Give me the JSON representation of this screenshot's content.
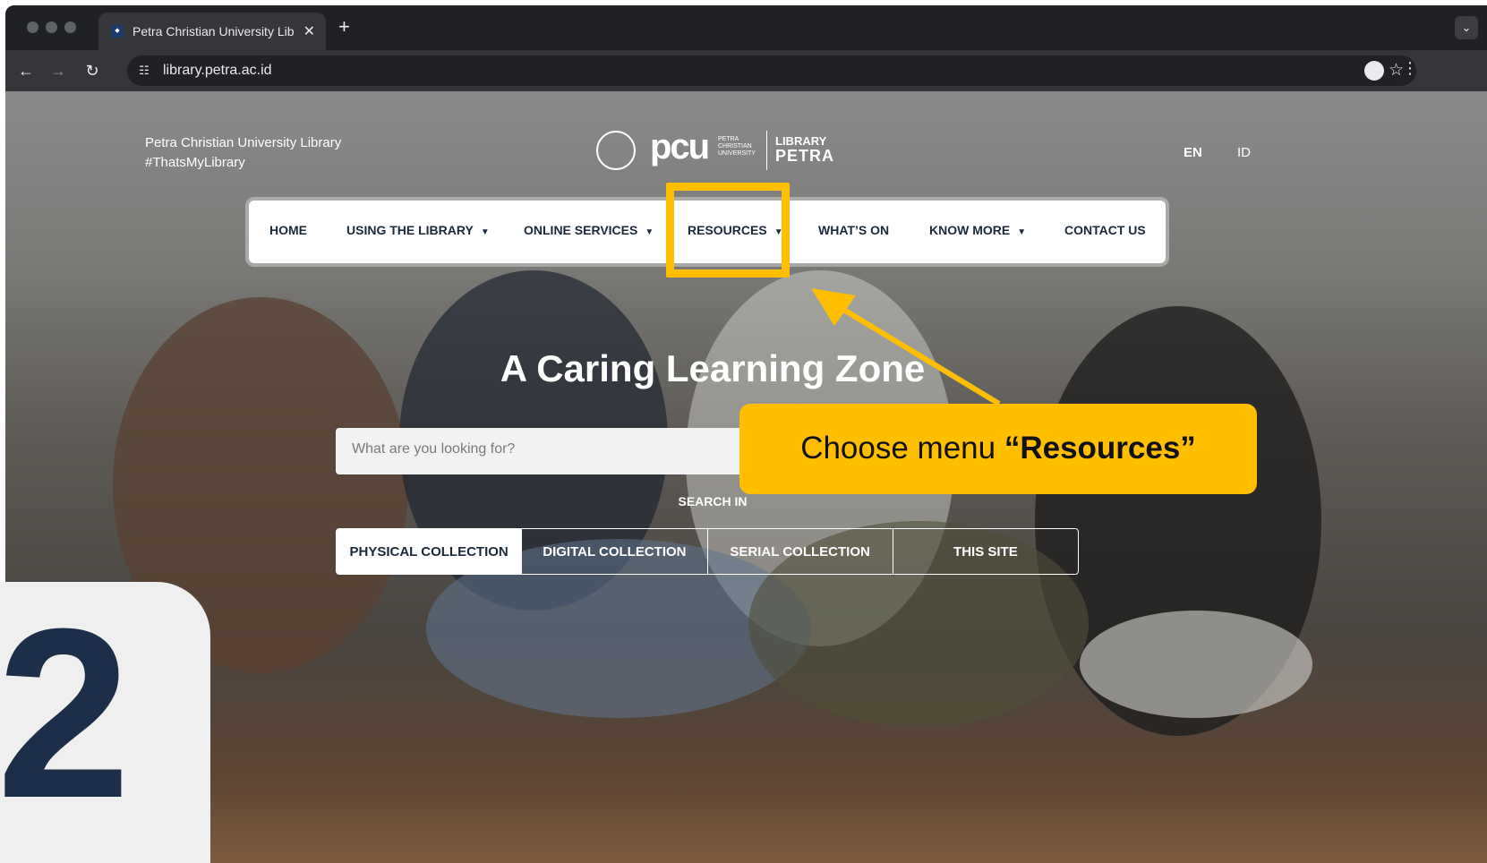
{
  "browser": {
    "tab_title": "Petra Christian University Lib",
    "new_tab_icon": "+",
    "url": "library.petra.ac.id"
  },
  "header": {
    "brand_line1": "Petra Christian University Library",
    "brand_line2": "#ThatsMyLibrary",
    "logo": {
      "pcu": "pcu",
      "pcu_sub": "PETRA CHRISTIAN UNIVERSITY",
      "library": "LIBRARY",
      "petra": "PETRA"
    },
    "languages": [
      "EN",
      "ID"
    ]
  },
  "nav": {
    "items": [
      {
        "label": "HOME"
      },
      {
        "label": "USING THE LIBRARY"
      },
      {
        "label": "ONLINE SERVICES"
      },
      {
        "label": "RESOURCES"
      },
      {
        "label": "WHAT’S ON"
      },
      {
        "label": "KNOW MORE"
      },
      {
        "label": "CONTACT US"
      }
    ]
  },
  "hero": {
    "title": "A Caring Learning Zone",
    "search_placeholder": "What are you looking for?",
    "search_in_label": "SEARCH IN",
    "collections": [
      "PHYSICAL COLLECTION",
      "DIGITAL COLLECTION",
      "SERIAL COLLECTION",
      "THIS SITE"
    ]
  },
  "annotation": {
    "callout_prefix": "Choose menu ",
    "callout_bold": "“Resources”",
    "step_number": "2",
    "highlight_color": "#ffbe00"
  }
}
